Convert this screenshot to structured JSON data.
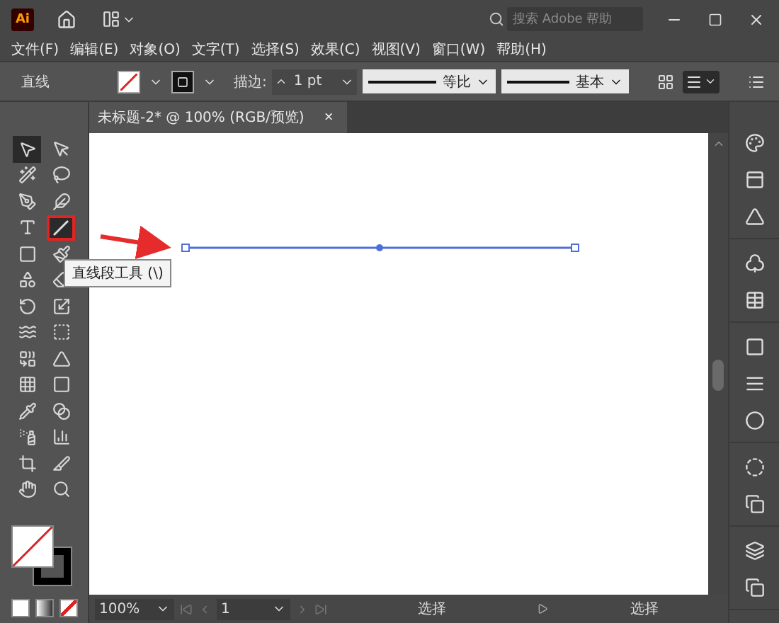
{
  "title_bar": {
    "app_logo": "Ai",
    "search": {
      "placeholder": "搜索 Adobe 帮助"
    }
  },
  "menu": [
    "文件(F)",
    "编辑(E)",
    "对象(O)",
    "文字(T)",
    "选择(S)",
    "效果(C)",
    "视图(V)",
    "窗口(W)",
    "帮助(H)"
  ],
  "control_bar": {
    "selection_label": "直线",
    "stroke_label": "描边:",
    "stroke_weight": "1 pt",
    "profile": "等比",
    "brush": "基本"
  },
  "document_tab": {
    "title": "未标题-2* @ 100% (RGB/预览)",
    "close": "×"
  },
  "tools": [
    {
      "selected": true,
      "highlighted": false
    },
    {
      "selected": false,
      "highlighted": false
    },
    {
      "selected": false,
      "highlighted": false
    },
    {
      "selected": false,
      "highlighted": false
    },
    {
      "selected": false,
      "highlighted": false
    },
    {
      "selected": false,
      "highlighted": false
    },
    {
      "selected": false,
      "highlighted": false
    },
    {
      "selected": true,
      "highlighted": true
    },
    {
      "selected": false,
      "highlighted": false
    },
    {
      "selected": false,
      "highlighted": false
    },
    {
      "selected": false,
      "highlighted": false
    },
    {
      "selected": false,
      "highlighted": false
    },
    {
      "selected": false,
      "highlighted": false
    },
    {
      "selected": false,
      "highlighted": false
    },
    {
      "selected": false,
      "highlighted": false
    },
    {
      "selected": false,
      "highlighted": false
    },
    {
      "selected": false,
      "highlighted": false
    },
    {
      "selected": false,
      "highlighted": false
    },
    {
      "selected": false,
      "highlighted": false
    },
    {
      "selected": false,
      "highlighted": false
    },
    {
      "selected": false,
      "highlighted": false
    },
    {
      "selected": false,
      "highlighted": false
    },
    {
      "selected": false,
      "highlighted": false
    },
    {
      "selected": false,
      "highlighted": false
    },
    {
      "selected": false,
      "highlighted": false
    },
    {
      "selected": false,
      "highlighted": false
    },
    {
      "selected": false,
      "highlighted": false
    },
    {
      "selected": false,
      "highlighted": false
    }
  ],
  "tooltip": "直线段工具 (\\)",
  "status_bar": {
    "zoom": "100%",
    "page": "1",
    "status": "选择",
    "status_2": "选择"
  }
}
